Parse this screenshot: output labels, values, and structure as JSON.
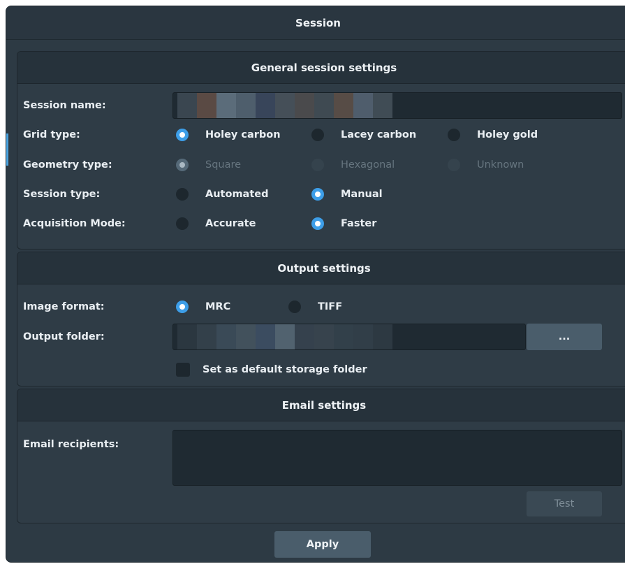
{
  "window": {
    "title": "Session"
  },
  "general": {
    "header": "General session settings",
    "session_name_label": "Session name:",
    "grid_type": {
      "label": "Grid type:",
      "options": [
        "Holey carbon",
        "Lacey carbon",
        "Holey gold"
      ],
      "selected": "Holey carbon"
    },
    "geometry_type": {
      "label": "Geometry type:",
      "options": [
        "Square",
        "Hexagonal",
        "Unknown"
      ],
      "selected": "Square",
      "disabled": true
    },
    "session_type": {
      "label": "Session type:",
      "options": [
        "Automated",
        "Manual"
      ],
      "selected": "Manual"
    },
    "acquisition_mode": {
      "label": "Acquisition Mode:",
      "options": [
        "Accurate",
        "Faster"
      ],
      "selected": "Faster"
    }
  },
  "output": {
    "header": "Output settings",
    "image_format": {
      "label": "Image format:",
      "options": [
        "MRC",
        "TIFF"
      ],
      "selected": "MRC"
    },
    "output_folder_label": "Output folder:",
    "browse_label": "...",
    "default_folder_checkbox": "Set as default storage folder",
    "default_folder_checked": false
  },
  "email": {
    "header": "Email settings",
    "recipients_label": "Email recipients:",
    "test_label": "Test"
  },
  "apply_label": "Apply",
  "colors": {
    "accent": "#3d9ee8",
    "background": "#2d3a44",
    "field": "#1f2a32"
  }
}
